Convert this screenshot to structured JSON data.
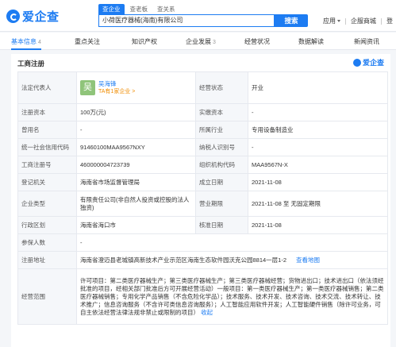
{
  "brand": {
    "logo_text": "爱企查"
  },
  "search": {
    "tabs": [
      "查企业",
      "查老板",
      "查关系"
    ],
    "value": "小荷医疗器械(海南)有限公司",
    "button": "搜索"
  },
  "top_right": {
    "apps": "应用",
    "mall": "企服商城",
    "login": "登"
  },
  "nav": [
    {
      "label": "基本信息",
      "count": "4"
    },
    {
      "label": "重点关注",
      "count": ""
    },
    {
      "label": "知识产权",
      "count": ""
    },
    {
      "label": "企业发展",
      "count": "3"
    },
    {
      "label": "经营状况",
      "count": ""
    },
    {
      "label": "数据解读",
      "count": ""
    },
    {
      "label": "新闻资讯",
      "count": ""
    }
  ],
  "card": {
    "title": "工商注册",
    "brand": "爱企查",
    "rows": {
      "legal_rep_key": "法定代表人",
      "legal_rep_avatar": "吴",
      "legal_rep_name": "吴海锋",
      "legal_rep_sub": "TA有1家企业 >",
      "status_key": "经营状态",
      "status_val": "开业",
      "capital_key": "注册资本",
      "capital_val": "100万(元)",
      "paid_key": "实缴资本",
      "paid_val": "-",
      "former_key": "曾用名",
      "former_val": "-",
      "industry_key": "所属行业",
      "industry_val": "专用设备制造业",
      "credit_key": "统一社会信用代码",
      "credit_val": "91460100MAA9567NXY",
      "tax_key": "纳税人识别号",
      "tax_val": "-",
      "regno_key": "工商注册号",
      "regno_val": "460000004723739",
      "org_key": "组织机构代码",
      "org_val": "MAA9567N-X",
      "authority_key": "登记机关",
      "authority_val": "海南省市场监督管理局",
      "founded_key": "成立日期",
      "founded_val": "2021-11-08",
      "type_key": "企业类型",
      "type_val": "有限责任公司(非自然人投资或控股的法人独资)",
      "term_key": "营业期限",
      "term_val": "2021-11-08 至 无固定期限",
      "region_key": "行政区划",
      "region_val": "海南省海口市",
      "approved_key": "核准日期",
      "approved_val": "2021-11-08",
      "insured_key": "参保人数",
      "insured_val": "-",
      "address_key": "注册地址",
      "address_val": "海南省澄迈县老城镇高新技术产业示范区海南生态软件园沃克公园8814一层1-2",
      "address_link": "查看地图",
      "scope_key": "经营范围",
      "scope_val": "许可项目：第二类医疗器械生产；第三类医疗器械生产；第三类医疗器械经营；货物进出口；技术进出口（依法须经批准的项目，经相关部门批准后方可开展经营活动）一般项目：第一类医疗器械生产；第一类医疗器械销售；第二类医疗器械销售；专用化学产品销售（不含危险化学品）；技术服务、技术开发、技术咨询、技术交流、技术转让、技术推广；信息咨询服务（不含许可类信息咨询服务）；人工智能应用软件开发；人工智能硬件销售（除许可业务，可自主依法经营法律法规非禁止或限制的项目）",
      "scope_link": "收起"
    }
  }
}
